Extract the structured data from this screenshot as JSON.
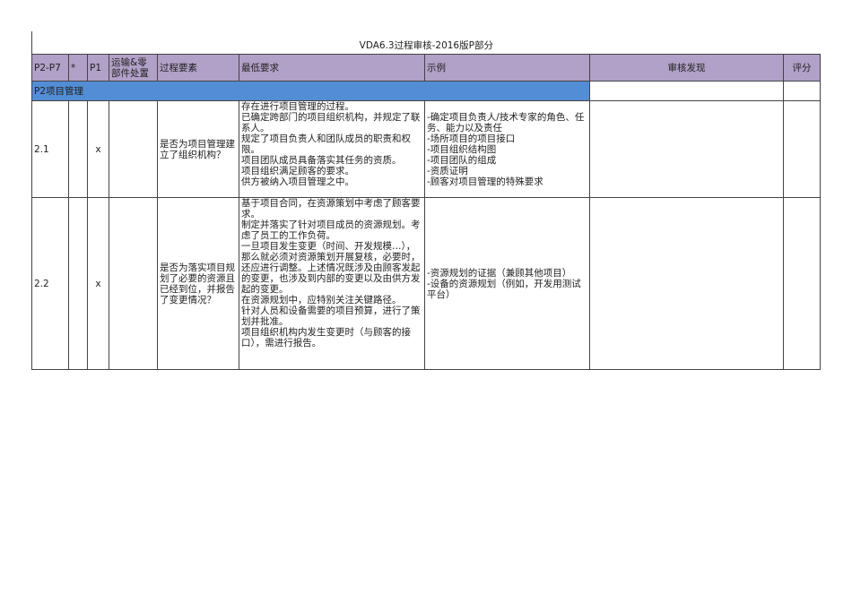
{
  "title": "VDA6.3过程审核-2016版P部分",
  "headers": {
    "p2p7": "P2-P7",
    "star": "*",
    "p1": "P1",
    "transport": "运输&零\n部件处置",
    "element": "过程要素",
    "min_req": "最低要求",
    "example": "示例",
    "findings": "审核发现",
    "score": "评分"
  },
  "section": "P2项目管理",
  "rows": [
    {
      "id": "2.1",
      "star": "",
      "p1": "x",
      "transport": "",
      "element": "是否为项目管理建立了组织机构？",
      "min_req": "存在进行项目管理的过程。\n已确定跨部门的项目组织机构，并规定了联系人。\n规定了项目负责人和团队成员的职责和权限。\n项目团队成员具备落实其任务的资质。\n项目组织满足顾客的要求。\n供方被纳入项目管理之中。",
      "example": "-确定项目负责人/技术专家的角色、任务、能力以及责任\n-场所项目的项目接口\n-项目组织结构图\n-项目团队的组成\n-资质证明\n-顾客对项目管理的特殊要求",
      "findings": "",
      "score": ""
    },
    {
      "id": "2.2",
      "star": "",
      "p1": "x",
      "transport": "",
      "element": "是否为落实项目规划了必要的资源且已经到位，并报告了变更情况？",
      "min_req": "基于项目合同，在资源策划中考虑了顾客要求。\n制定并落实了针对项目成员的资源规划。考虑了员工的工作负荷。\n一旦项目发生变更（时间、开发规模…），那么就必须对资源策划开展复核，必要时，还应进行调整。上述情况既涉及由顾客发起的变更，也涉及到内部的变更以及由供方发起的变更。\n在资源规划中，应特别关注关键路径。\n针对人员和设备需要的项目预算，进行了策划并批准。\n项目组织机构内发生变更时（与顾客的接口），需进行报告。",
      "example": "-资源规划的证据（兼顾其他项目）\n-设备的资源规划（例如，开发用测试平台）",
      "findings": "",
      "score": ""
    }
  ]
}
